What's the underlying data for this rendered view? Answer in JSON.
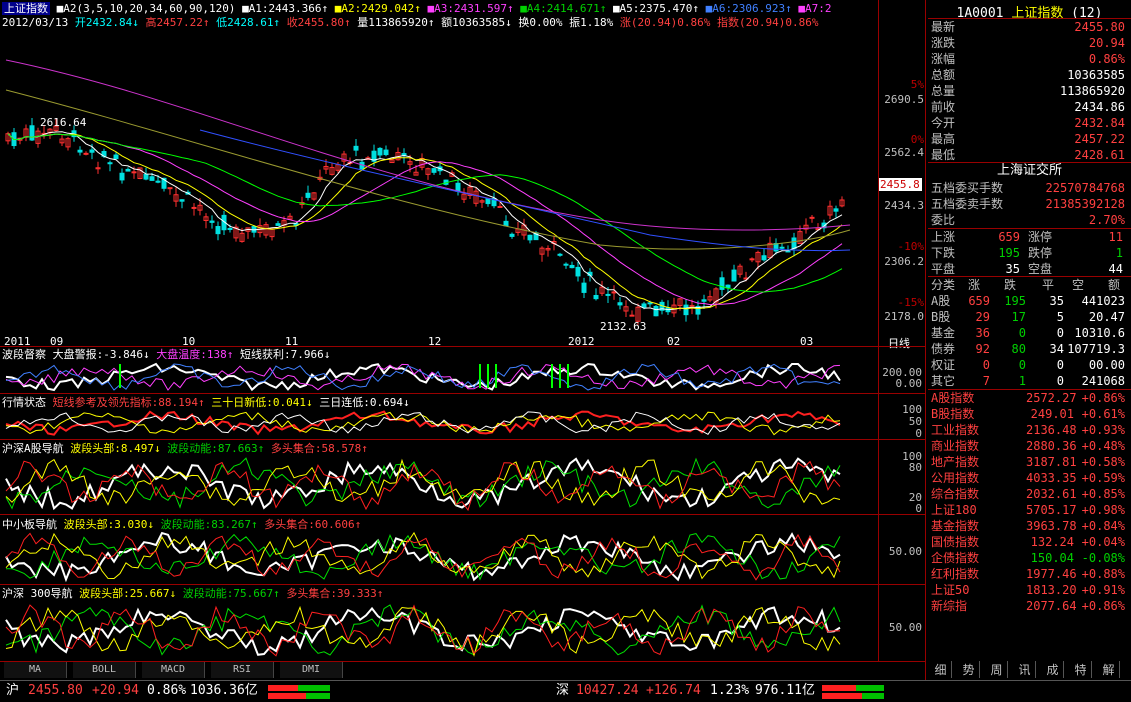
{
  "main": {
    "title": "上证指数",
    "ma_params": "■A2(3,5,10,20,34,60,90,120)",
    "ma1": "■A1:2443.366↑",
    "ma2": "■A2:2429.042↑",
    "ma3": "■A3:2431.597↑",
    "ma4": "■A4:2414.671↑",
    "ma5": "■A5:2375.470↑",
    "ma6": "■A6:2306.923↑",
    "ma7": "■A7:2",
    "date": "2012/03/13",
    "open": "开2432.84↓",
    "high": "高2457.22↑",
    "low": "低2428.61↑",
    "close": "收2455.80↑",
    "vol": "量113865920↑",
    "amt": "额10363585↓",
    "turn": "换0.00%",
    "amp": "振1.18%",
    "chg": "涨(20.94)0.86%",
    "idx": "指数(20.94)0.86%",
    "yaxis": [
      {
        "pct": "5%",
        "val": "2690.5"
      },
      {
        "pct": "0%",
        "val": "2562.4"
      },
      {
        "pct": "",
        "val": "2434.3"
      },
      {
        "pct": "-10%",
        "val": "2306.2"
      },
      {
        "pct": "-15%",
        "val": "2178.0"
      }
    ],
    "last_price_tag": "2455.8",
    "annot_high": "2616.64",
    "annot_low": "2132.63",
    "xaxis": [
      "2011",
      "09",
      "10",
      "11",
      "12",
      "2012",
      "02",
      "03"
    ],
    "period": "日线"
  },
  "p1": {
    "name": "波段督察",
    "a": "大盘警报:-3.846↓",
    "b": "大盘温度:138↑",
    "c": "短线获利:7.966↓",
    "y1": "200.00",
    "y2": "0.00"
  },
  "p2": {
    "name": "行情状态",
    "a": "短线参考及领先指标:88.194↑",
    "b": "三十日新低:0.041↓",
    "c": "三日连低:0.694↓",
    "y1": "100",
    "y2": "50",
    "y3": "0"
  },
  "p3": {
    "name": "沪深A股导航",
    "a": "波段头部:8.497↓",
    "b": "波段动能:87.663↑",
    "c": "多头集合:58.578↑",
    "y1": "100",
    "y2": "80",
    "y3": "20",
    "y4": "0"
  },
  "p4": {
    "name": "中小板导航",
    "a": "波段头部:3.030↓",
    "b": "波段动能:83.267↑",
    "c": "多头集合:60.606↑",
    "y1": "50.00"
  },
  "p5": {
    "name": "沪深 300导航",
    "a": "波段头部:25.667↓",
    "b": "波段动能:75.667↑",
    "c": "多头集合:39.333↑",
    "y1": "50.00"
  },
  "btabs": [
    "MA",
    "BOLL",
    "MACD",
    "RSI",
    "DMI"
  ],
  "right": {
    "code": "1A0001",
    "name": "上证指数",
    "count": "(12)",
    "quote": [
      {
        "l": "最新",
        "v": "2455.80",
        "c": "red"
      },
      {
        "l": "涨跌",
        "v": "20.94",
        "c": "red"
      },
      {
        "l": "涨幅",
        "v": "0.86%",
        "c": "red"
      },
      {
        "l": "总额",
        "v": "10363585",
        "c": "wht"
      },
      {
        "l": "总量",
        "v": "113865920",
        "c": "wht"
      },
      {
        "l": "前收",
        "v": "2434.86",
        "c": "wht"
      },
      {
        "l": "今开",
        "v": "2432.84",
        "c": "red"
      },
      {
        "l": "最高",
        "v": "2457.22",
        "c": "red"
      },
      {
        "l": "最低",
        "v": "2428.61",
        "c": "red"
      }
    ],
    "exchange": "上海证交所",
    "buy_label": "五档委买手数",
    "buy_val": "22570784768",
    "sell_label": "五档委卖手数",
    "sell_val": "21385392128",
    "ratio_label": "委比",
    "ratio_val": "2.70%",
    "up_label": "上涨",
    "up_val": "659",
    "limitup_label": "涨停",
    "limitup_val": "11",
    "down_label": "下跌",
    "down_val": "195",
    "limitdown_label": "跌停",
    "limitdown_val": "1",
    "flat_label": "平盘",
    "flat_val": "35",
    "short_label": "空盘",
    "short_val": "44",
    "table_head": [
      "分类",
      "涨",
      "跌",
      "平",
      "空",
      "额"
    ],
    "table": [
      [
        "A股",
        "659",
        "195",
        "35",
        "441023"
      ],
      [
        "B股",
        "29",
        "17",
        "5",
        "20.47"
      ],
      [
        "基金",
        "36",
        "0",
        "0",
        "10310.6"
      ],
      [
        "债券",
        "92",
        "80",
        "34",
        "107719.3"
      ],
      [
        "权证",
        "0",
        "0",
        "0",
        "00.00"
      ],
      [
        "其它",
        "7",
        "1",
        "0",
        "241068"
      ]
    ],
    "indices": [
      {
        "n": "A股指数",
        "p": "2572.27",
        "c": "+0.86%",
        "cls": "red"
      },
      {
        "n": "B股指数",
        "p": "249.01",
        "c": "+0.61%",
        "cls": "red"
      },
      {
        "n": "工业指数",
        "p": "2136.48",
        "c": "+0.93%",
        "cls": "red"
      },
      {
        "n": "商业指数",
        "p": "2880.36",
        "c": "+0.48%",
        "cls": "red"
      },
      {
        "n": "地产指数",
        "p": "3187.81",
        "c": "+0.58%",
        "cls": "red"
      },
      {
        "n": "公用指数",
        "p": "4033.35",
        "c": "+0.59%",
        "cls": "red"
      },
      {
        "n": "综合指数",
        "p": "2032.61",
        "c": "+0.85%",
        "cls": "red"
      },
      {
        "n": "上证180",
        "p": "5705.17",
        "c": "+0.98%",
        "cls": "red"
      },
      {
        "n": "基金指数",
        "p": "3963.78",
        "c": "+0.84%",
        "cls": "red"
      },
      {
        "n": "国债指数",
        "p": "132.24",
        "c": "+0.04%",
        "cls": "red"
      },
      {
        "n": "企债指数",
        "p": "150.04",
        "c": "-0.08%",
        "cls": "grn"
      },
      {
        "n": "红利指数",
        "p": "1977.46",
        "c": "+0.88%",
        "cls": "red"
      },
      {
        "n": "上证50",
        "p": "1813.20",
        "c": "+0.91%",
        "cls": "red"
      },
      {
        "n": "新综指",
        "p": "2077.64",
        "c": "+0.86%",
        "cls": "red"
      }
    ],
    "tabs": [
      "细",
      "势",
      "周",
      "讯",
      "成",
      "特",
      "解"
    ]
  },
  "status": {
    "sh_label": "沪",
    "sh_price": "2455.80",
    "sh_chg": "+20.94",
    "sh_pct": "0.86%",
    "sh_amt": "1036.36亿",
    "sz_label": "深",
    "sz_price": "10427.24",
    "sz_chg": "+126.74",
    "sz_pct": "1.23%",
    "sz_amt": "976.11亿"
  },
  "colors": {
    "up": "#ff4040",
    "down": "#00ffff",
    "border": "#990000",
    "bg": "#000000"
  }
}
